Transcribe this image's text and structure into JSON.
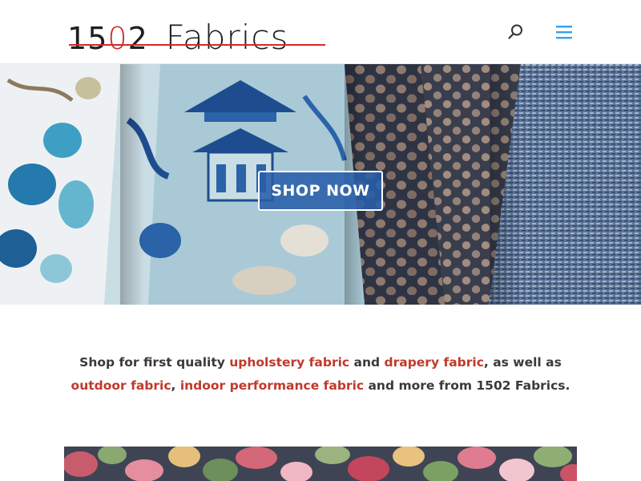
{
  "header": {
    "logo": {
      "d1": "1",
      "d2": "5",
      "d3": "0",
      "d4": "2",
      "word": "Fabrics",
      "accent_color": "#d12a2a"
    },
    "search_icon": "search-icon",
    "menu_icon": "hamburger-menu-icon",
    "icon_color": "#2ea3f2"
  },
  "hero": {
    "button_label": "SHOP NOW",
    "button_color": "#285faa"
  },
  "intro": {
    "part1": "Shop for first quality ",
    "link1": "upholstery fabric",
    "part2": " and ",
    "link2": "drapery fabric",
    "part3": ", as well as ",
    "link3": "outdoor fabric",
    "part4": ", ",
    "link4": "indoor performance fabric",
    "part5": " and more from 1502 Fabrics.",
    "link_color": "#c0392b",
    "text_color": "#3a3a3a"
  }
}
